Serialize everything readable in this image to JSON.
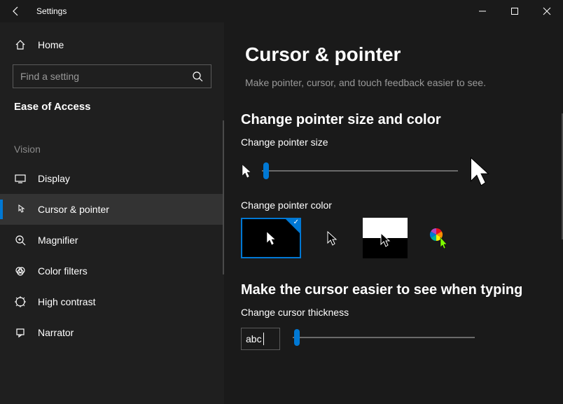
{
  "window": {
    "title": "Settings"
  },
  "sidebar": {
    "home": "Home",
    "search_placeholder": "Find a setting",
    "section": "Ease of Access",
    "group": "Vision",
    "items": [
      {
        "label": "Display"
      },
      {
        "label": "Cursor & pointer"
      },
      {
        "label": "Magnifier"
      },
      {
        "label": "Color filters"
      },
      {
        "label": "High contrast"
      },
      {
        "label": "Narrator"
      }
    ]
  },
  "page": {
    "title": "Cursor & pointer",
    "subtitle": "Make pointer, cursor, and touch feedback easier to see.",
    "section1_title": "Change pointer size and color",
    "size_label": "Change pointer size",
    "color_label": "Change pointer color",
    "section2_title": "Make the cursor easier to see when typing",
    "thickness_label": "Change cursor thickness",
    "abc_sample": "abc"
  }
}
